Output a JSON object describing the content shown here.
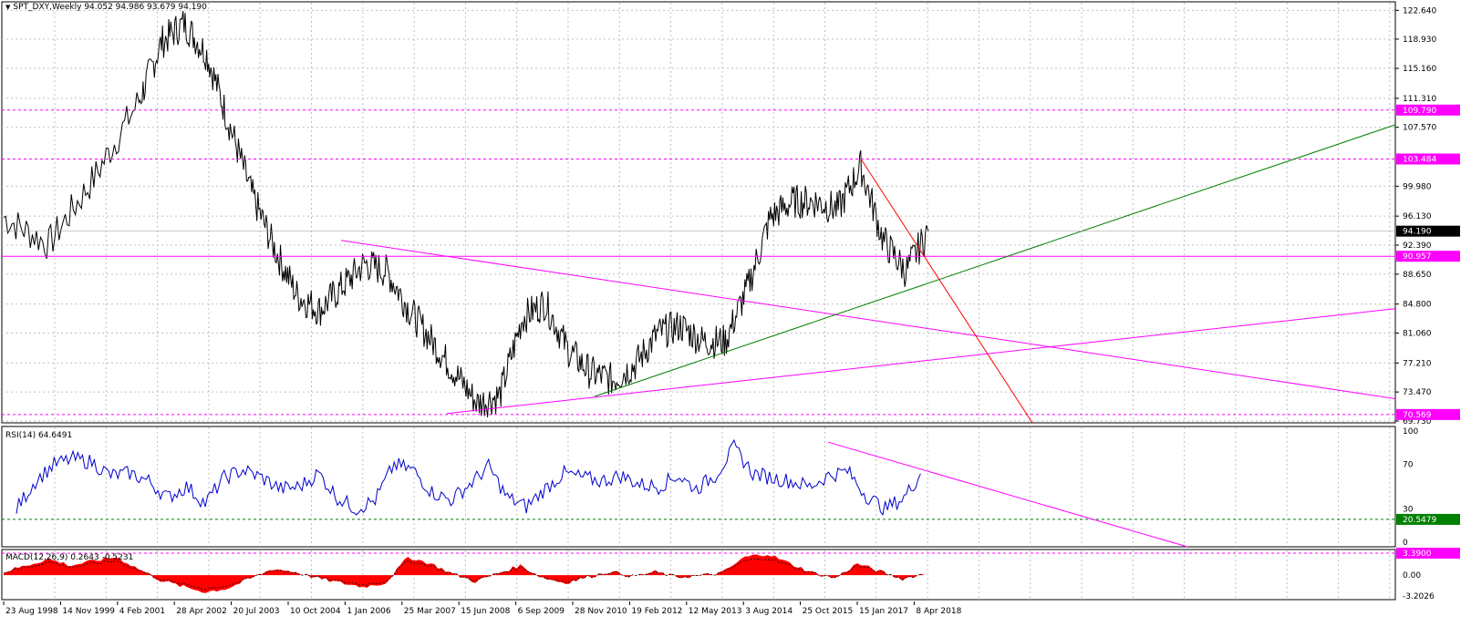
{
  "window": {
    "main_header": "SPT_DXY,Weekly  94.052 94.986 93.679 94.190",
    "rsi_header": "RSI(14) 64.6491",
    "macd_header": "MACD(12,26,9) 0.2643 -0.5231"
  },
  "colors": {
    "price_line": "#000000",
    "grid": "#c0c0c0",
    "magenta": "#ff00ff",
    "green_trend": "#008000",
    "red_trend": "#ff0000",
    "rsi_line": "#0000cc",
    "macd_fill": "#ff0000",
    "level_label_bg": "#ff00ff",
    "current_price_bg": "#000000"
  },
  "main_axis": {
    "ticks": [
      "122.640",
      "118.930",
      "115.160",
      "111.310",
      "107.570",
      "99.980",
      "96.130",
      "92.390",
      "88.650",
      "84.800",
      "81.060",
      "77.210",
      "73.470",
      "69.730"
    ],
    "level_labels": [
      "109.790",
      "103.484",
      "90.957",
      "70.569"
    ],
    "current_price": "94.190"
  },
  "rsi_axis": {
    "ticks": [
      "100",
      "70",
      "30",
      "0"
    ],
    "level_label": "20.5479"
  },
  "macd_axis": {
    "ticks": [
      "3.3900",
      "0.00",
      "-3.2026"
    ],
    "level_label": "3.3900"
  },
  "time_axis": [
    "23 Aug 1998",
    "14 Nov 1999",
    "4 Feb 2001",
    "28 Apr 2002",
    "20 Jul 2003",
    "10 Oct 2004",
    "1 Jan 2006",
    "25 Mar 2007",
    "15 Jun 2008",
    "6 Sep 2009",
    "28 Nov 2010",
    "19 Feb 2012",
    "12 May 2013",
    "3 Aug 2014",
    "25 Oct 2015",
    "15 Jan 2017",
    "8 Apr 2018"
  ],
  "chart_data": {
    "type": "line",
    "title": "SPT_DXY,Weekly",
    "x": [
      "1998",
      "1999",
      "2000",
      "2001",
      "2001.5",
      "2002",
      "2002.5",
      "2003",
      "2003.5",
      "2004",
      "2004.5",
      "2005",
      "2005.5",
      "2006",
      "2006.5",
      "2007",
      "2007.5",
      "2008",
      "2008.5",
      "2009",
      "2009.5",
      "2010",
      "2010.5",
      "2011",
      "2011.5",
      "2012",
      "2012.5",
      "2013",
      "2013.5",
      "2014",
      "2014.5",
      "2015",
      "2015.5",
      "2016",
      "2016.5",
      "2017",
      "2017.5",
      "2018",
      "2018.5"
    ],
    "series": [
      {
        "name": "SPT_DXY",
        "values": [
          96,
          92.5,
          101,
          111,
          118.5,
          121,
          117,
          108,
          99,
          92,
          86,
          84,
          87,
          90,
          89,
          84,
          80,
          76,
          72,
          73,
          83,
          85,
          79,
          76,
          75,
          77,
          81,
          82,
          80,
          80,
          87,
          96,
          98,
          98,
          97,
          102.5,
          93,
          89,
          94.19
        ]
      }
    ],
    "ylim": [
      69.73,
      123.5
    ],
    "rsi": {
      "name": "RSI(14)",
      "last": 64.6491,
      "ylim": [
        0,
        100
      ],
      "values": [
        30,
        55,
        70,
        75,
        72,
        60,
        62,
        55,
        40,
        50,
        35,
        58,
        65,
        58,
        48,
        50,
        62,
        40,
        30,
        38,
        70,
        65,
        45,
        38,
        52,
        68,
        40,
        32,
        48,
        62,
        58,
        55,
        60,
        52,
        50,
        60,
        48,
        60,
        85,
        62,
        58,
        55,
        50,
        60,
        64,
        42,
        30,
        40,
        64.6
      ]
    },
    "macd": {
      "name": "MACD(12,26,9)",
      "main": 0.2643,
      "signal": -0.5231,
      "ylim": [
        -3.2026,
        3.39
      ],
      "values": [
        0.5,
        1.5,
        2.5,
        1.5,
        2.2,
        2.8,
        1.0,
        -0.8,
        -1.8,
        -2.6,
        -2.0,
        -0.5,
        1.0,
        0.5,
        -0.5,
        -1.2,
        -1.8,
        -1.2,
        2.8,
        1.8,
        0.2,
        -1.0,
        0.3,
        1.5,
        -0.4,
        -1.2,
        -0.3,
        0.6,
        -0.2,
        0.5,
        -0.3,
        -0.1,
        0.4,
        2.8,
        3.3,
        1.8,
        0.4,
        -0.5,
        1.8,
        0.6,
        -0.6,
        0.26
      ]
    }
  }
}
